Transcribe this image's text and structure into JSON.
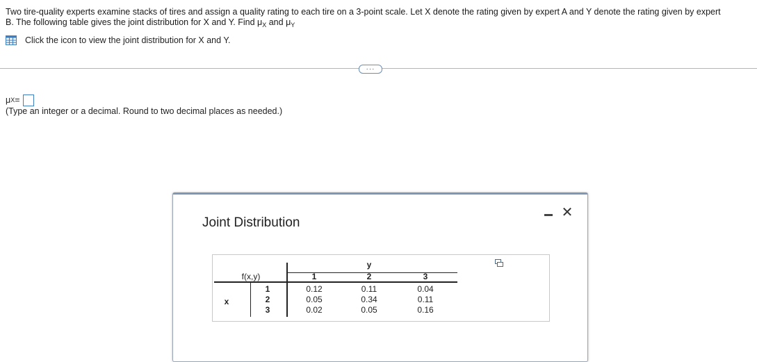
{
  "problem": {
    "text_line1": "Two tire-quality experts examine stacks of tires and assign a quality rating to each tire on a 3-point scale. Let X denote the rating given by expert A and Y denote the rating given by expert",
    "text_line2_prefix": "B. The following table gives the joint distribution for X and Y. Find ",
    "mu_x_symbol": "μ",
    "mu_x_sub": "X",
    "and_word": " and ",
    "mu_y_symbol": "μ",
    "mu_y_sub": "Y"
  },
  "icon_link": {
    "icon": "table-grid-icon",
    "label": "Click the icon to view the joint distribution for X and Y."
  },
  "more_button": {
    "label": "···"
  },
  "answer": {
    "symbol": "μ",
    "sub": "X",
    "equals": " =",
    "value": "",
    "hint": "(Type an integer or a decimal. Round to two decimal places as needed.)"
  },
  "dialog": {
    "title": "Joint Distribution",
    "minimize_icon": "minimize-icon",
    "close_icon": "close-icon",
    "close_glyph": "✕",
    "copy_icon": "copy-icon",
    "table": {
      "fxy_label": "f(x,y)",
      "y_label": "y",
      "x_label": "x",
      "col_headers": [
        "1",
        "2",
        "3"
      ],
      "row_headers": [
        "1",
        "2",
        "3"
      ],
      "rows": [
        [
          "0.12",
          "0.11",
          "0.04"
        ],
        [
          "0.05",
          "0.34",
          "0.11"
        ],
        [
          "0.02",
          "0.05",
          "0.16"
        ]
      ]
    }
  },
  "colors": {
    "accent": "#3f7fbf",
    "dialog_border": "#7e98b3",
    "divider": "#b5b5b5"
  }
}
